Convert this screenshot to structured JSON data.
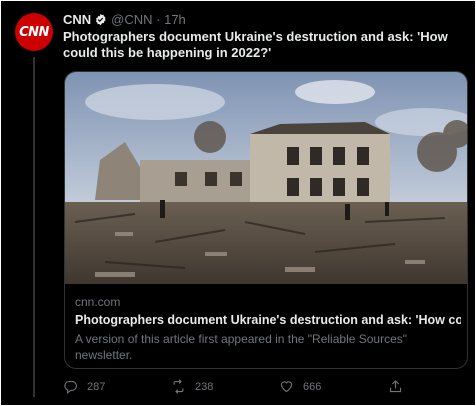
{
  "tweet": {
    "avatar_text": "CNN",
    "author": "CNN",
    "handle": "@CNN · 17h",
    "text": "Photographers document Ukraine's destruction and ask: 'How could this be happening in 2022?'"
  },
  "card": {
    "domain": "cnn.com",
    "title": "Photographers document Ukraine's destruction and ask: 'How could t...",
    "description": "A version of this article first appeared in the \"Reliable Sources\" newsletter."
  },
  "actions": {
    "replies": "287",
    "retweets": "238",
    "likes": "666"
  },
  "colors": {
    "background": "#000000",
    "brand_red": "#cc0000",
    "verified_blue": "#1d9bf0",
    "text_primary": "#e7e9ea",
    "text_secondary": "#71767b"
  },
  "icons": [
    "verified-badge-icon",
    "reply-icon",
    "retweet-icon",
    "like-icon",
    "share-icon"
  ]
}
